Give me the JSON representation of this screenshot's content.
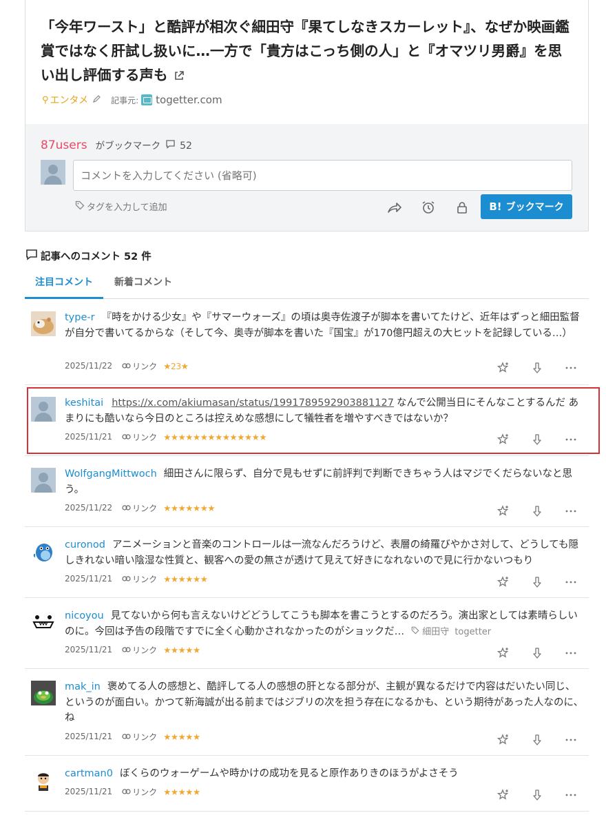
{
  "entry": {
    "title": "「今年ワースト」と酷評が相次ぐ細田守『果てしなきスカーレット』、なぜか映画鑑賞ではなく肝試し扱いに…一方で「貴方はこっち側の人」と『オマツリ男爵』を思い出し評価する声も",
    "category": "エンタメ",
    "source_label": "記事元:",
    "source_host": "togetter.com"
  },
  "bookmark_panel": {
    "users_count": "87users",
    "users_suffix": "がブックマーク",
    "comment_count": "52",
    "comment_placeholder": "コメントを入力してください (省略可)",
    "tag_placeholder": "タグを入力して追加",
    "button_mark": "B!",
    "button_label": "ブックマーク"
  },
  "comments_section": {
    "heading": "記事へのコメント 52 件",
    "tabs": [
      {
        "label": "注目コメント",
        "active": true
      },
      {
        "label": "新着コメント",
        "active": false
      }
    ]
  },
  "comments": [
    {
      "user": "type-r",
      "text": "『時をかける少女』や『サマーウォーズ』の頃は奥寺佐渡子が脚本を書いてたけど、近年はずっと細田監督が自分で書いてるからな（そして今、奥寺が脚本を書いた『国宝』が170億円超えの大ヒットを記録している…）",
      "date": "2025/11/22",
      "link_label": "リンク",
      "stars": "★23★"
    },
    {
      "user": "keshitai",
      "url": "https://x.com/akiumasan/status/1991789592903881127",
      "text": "なんで公開当日にそんなことするんだ あまりにも酷いなら今日のところは控えめな感想にして犠牲者を増やすべきではないか？",
      "date": "2025/11/21",
      "link_label": "リンク",
      "stars": "★★★★★★★★★★★★★★"
    },
    {
      "user": "WolfgangMittwoch",
      "text": "細田さんに限らず、自分で見もせずに前評判で判断できちゃう人はマジでくだらないなと思う。",
      "date": "2025/11/22",
      "link_label": "リンク",
      "stars": "★★★★★★★"
    },
    {
      "user": "curonod",
      "text": "アニメーションと音楽のコントロールは一流なんだろうけど、表層の綺羅びやかさ対して、どうしても隠しきれない暗い陰湿な性質と、観客への愛の無さが透けて見えて好きになれないので見に行かないつもり",
      "date": "2025/11/21",
      "link_label": "リンク",
      "stars": "★★★★★★"
    },
    {
      "user": "nicoyou",
      "text": "見てないから何も言えないけどどうしてこうも脚本を書こうとするのだろう。演出家としては素晴らしいのに。今回は予告の段階ですでに全く心動かされなかったのがショックだ…",
      "tag": "細田守",
      "tag_host": "togetter",
      "date": "2025/11/21",
      "link_label": "リンク",
      "stars": "★★★★★"
    },
    {
      "user": "mak_in",
      "text": "褒めてる人の感想と、酷評してる人の感想の肝となる部分が、主観が異なるだけで内容はだいたい同じ、というのが面白い。かつて新海誠が出る前まではジブリの次を担う存在になるかも、という期待があった人なのに、ね",
      "date": "2025/11/21",
      "link_label": "リンク",
      "stars": "★★★★★"
    },
    {
      "user": "cartman0",
      "text": "ぼくらのウォーゲームや時かけの成功を見ると原作ありきのほうがよさそう",
      "date": "2025/11/21",
      "link_label": "リンク",
      "stars": "★★★★★"
    }
  ],
  "colors": {
    "accent_blue": "#1c8dd0",
    "users_red": "#ea4866",
    "star_orange": "#f0a833",
    "category_orange": "#e8a317",
    "highlight_red": "#d63134"
  },
  "icons": [
    "external-link-icon",
    "pin-icon",
    "pencil-icon",
    "favicon",
    "comment-bubble-icon",
    "tag-icon",
    "share-icon",
    "alarm-icon",
    "lock-icon",
    "link-icon",
    "add-star-icon",
    "down-arrow-icon",
    "more-icon"
  ]
}
